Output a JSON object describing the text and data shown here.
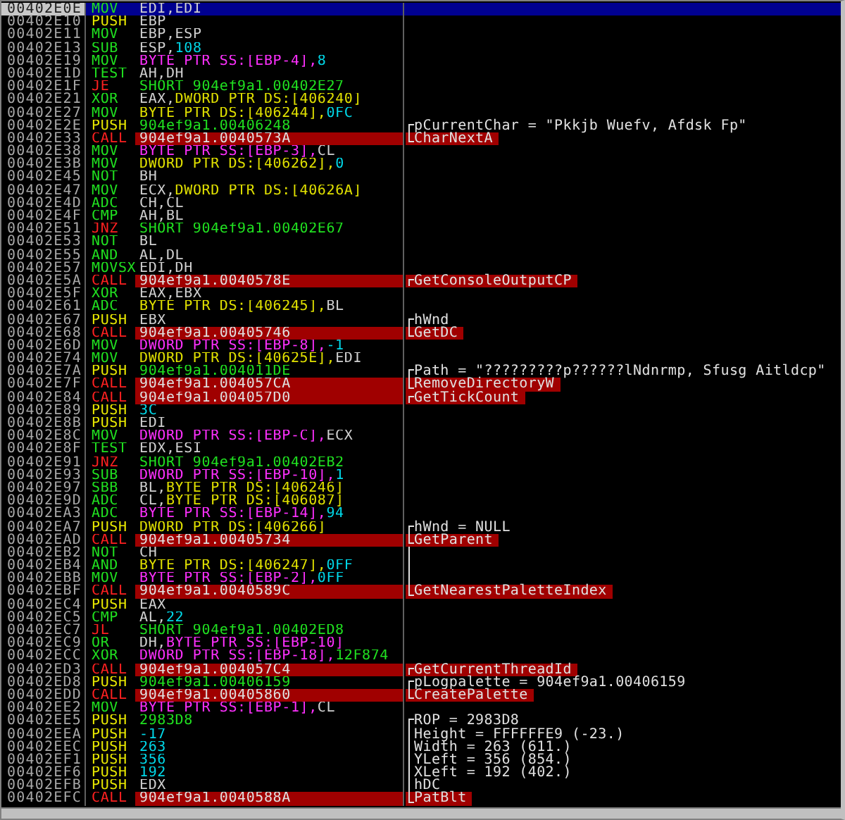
{
  "rows": [
    {
      "address": "00402E0E",
      "selected": true,
      "kind": "op",
      "mnemonic": "MOV",
      "operands": [
        {
          "text": "EDI,",
          "kind": "reg"
        },
        {
          "text": "EDI",
          "kind": "reg"
        }
      ]
    },
    {
      "address": "00402E10",
      "selected": false,
      "kind": "push",
      "mnemonic": "PUSH",
      "operands": [
        {
          "text": "EBP",
          "kind": "reg"
        }
      ]
    },
    {
      "address": "00402E11",
      "selected": false,
      "kind": "op",
      "mnemonic": "MOV",
      "operands": [
        {
          "text": "EBP,",
          "kind": "reg"
        },
        {
          "text": "ESP",
          "kind": "reg"
        }
      ]
    },
    {
      "address": "00402E13",
      "selected": false,
      "kind": "op",
      "mnemonic": "SUB",
      "operands": [
        {
          "text": "ESP,",
          "kind": "reg"
        },
        {
          "text": "108",
          "kind": "const"
        }
      ]
    },
    {
      "address": "00402E19",
      "selected": false,
      "kind": "op",
      "mnemonic": "MOV",
      "operands": [
        {
          "text": "BYTE PTR SS:[EBP-4],",
          "kind": "stack"
        },
        {
          "text": "8",
          "kind": "const"
        }
      ]
    },
    {
      "address": "00402E1D",
      "selected": false,
      "kind": "op",
      "mnemonic": "TEST",
      "operands": [
        {
          "text": "AH,",
          "kind": "reg"
        },
        {
          "text": "DH",
          "kind": "reg"
        }
      ]
    },
    {
      "address": "00402E1F",
      "selected": false,
      "kind": "jump",
      "mnemonic": "JE",
      "operands": [
        {
          "text": "SHORT 904ef9a1.00402E27",
          "kind": "addr"
        }
      ]
    },
    {
      "address": "00402E21",
      "selected": false,
      "kind": "op",
      "mnemonic": "XOR",
      "operands": [
        {
          "text": "EAX,",
          "kind": "reg"
        },
        {
          "text": "DWORD PTR DS:[406240]",
          "kind": "data"
        }
      ]
    },
    {
      "address": "00402E27",
      "selected": false,
      "kind": "op",
      "mnemonic": "MOV",
      "operands": [
        {
          "text": "BYTE PTR DS:[406244],",
          "kind": "data"
        },
        {
          "text": "0FC",
          "kind": "const"
        }
      ]
    },
    {
      "address": "00402E2E",
      "selected": false,
      "kind": "push",
      "mnemonic": "PUSH",
      "operands": [
        {
          "text": "904ef9a1.00406248",
          "kind": "addr"
        }
      ],
      "bracket": {
        "kind": "start"
      },
      "comment": {
        "text": "pCurrentChar = \"Pkkjb Wuefv, Afdsk Fp\"",
        "kind": "arg"
      }
    },
    {
      "address": "00402E33",
      "selected": false,
      "kind": "call",
      "mnemonic": "CALL",
      "operands": [
        {
          "text": "904ef9a1.0040573A",
          "kind": "addr"
        }
      ],
      "bracket": {
        "kind": "end"
      },
      "comment": {
        "text": "CharNextA",
        "kind": "api"
      }
    },
    {
      "address": "00402E38",
      "selected": false,
      "kind": "op",
      "mnemonic": "MOV",
      "operands": [
        {
          "text": "BYTE PTR SS:[EBP-3],",
          "kind": "stack"
        },
        {
          "text": "CL",
          "kind": "reg"
        }
      ]
    },
    {
      "address": "00402E3B",
      "selected": false,
      "kind": "op",
      "mnemonic": "MOV",
      "operands": [
        {
          "text": "DWORD PTR DS:[406262],",
          "kind": "data"
        },
        {
          "text": "0",
          "kind": "const"
        }
      ]
    },
    {
      "address": "00402E45",
      "selected": false,
      "kind": "op",
      "mnemonic": "NOT",
      "operands": [
        {
          "text": "BH",
          "kind": "reg"
        }
      ]
    },
    {
      "address": "00402E47",
      "selected": false,
      "kind": "op",
      "mnemonic": "MOV",
      "operands": [
        {
          "text": "ECX,",
          "kind": "reg"
        },
        {
          "text": "DWORD PTR DS:[40626A]",
          "kind": "data"
        }
      ]
    },
    {
      "address": "00402E4D",
      "selected": false,
      "kind": "op",
      "mnemonic": "ADC",
      "operands": [
        {
          "text": "CH,",
          "kind": "reg"
        },
        {
          "text": "CL",
          "kind": "reg"
        }
      ]
    },
    {
      "address": "00402E4F",
      "selected": false,
      "kind": "op",
      "mnemonic": "CMP",
      "operands": [
        {
          "text": "AH,",
          "kind": "reg"
        },
        {
          "text": "BL",
          "kind": "reg"
        }
      ]
    },
    {
      "address": "00402E51",
      "selected": false,
      "kind": "jump",
      "mnemonic": "JNZ",
      "operands": [
        {
          "text": "SHORT 904ef9a1.00402E67",
          "kind": "addr"
        }
      ]
    },
    {
      "address": "00402E53",
      "selected": false,
      "kind": "op",
      "mnemonic": "NOT",
      "operands": [
        {
          "text": "BL",
          "kind": "reg"
        }
      ]
    },
    {
      "address": "00402E55",
      "selected": false,
      "kind": "op",
      "mnemonic": "AND",
      "operands": [
        {
          "text": "AL,",
          "kind": "reg"
        },
        {
          "text": "DL",
          "kind": "reg"
        }
      ]
    },
    {
      "address": "00402E57",
      "selected": false,
      "kind": "op",
      "mnemonic": "MOVSX",
      "operands": [
        {
          "text": "EDI,",
          "kind": "reg"
        },
        {
          "text": "DH",
          "kind": "reg"
        }
      ]
    },
    {
      "address": "00402E5A",
      "selected": false,
      "kind": "call",
      "mnemonic": "CALL",
      "operands": [
        {
          "text": "904ef9a1.0040578E",
          "kind": "addr"
        }
      ],
      "bracket": {
        "kind": "single"
      },
      "comment": {
        "text": "GetConsoleOutputCP",
        "kind": "api"
      }
    },
    {
      "address": "00402E5F",
      "selected": false,
      "kind": "op",
      "mnemonic": "XOR",
      "operands": [
        {
          "text": "EAX,",
          "kind": "reg"
        },
        {
          "text": "EBX",
          "kind": "reg"
        }
      ]
    },
    {
      "address": "00402E61",
      "selected": false,
      "kind": "op",
      "mnemonic": "ADC",
      "operands": [
        {
          "text": "BYTE PTR DS:[406245],",
          "kind": "data"
        },
        {
          "text": "BL",
          "kind": "reg"
        }
      ]
    },
    {
      "address": "00402E67",
      "selected": false,
      "kind": "push",
      "mnemonic": "PUSH",
      "operands": [
        {
          "text": "EBX",
          "kind": "reg"
        }
      ],
      "bracket": {
        "kind": "start"
      },
      "comment": {
        "text": "hWnd",
        "kind": "arg"
      }
    },
    {
      "address": "00402E68",
      "selected": false,
      "kind": "call",
      "mnemonic": "CALL",
      "operands": [
        {
          "text": "904ef9a1.00405746",
          "kind": "addr"
        }
      ],
      "bracket": {
        "kind": "end"
      },
      "comment": {
        "text": "GetDC",
        "kind": "api"
      }
    },
    {
      "address": "00402E6D",
      "selected": false,
      "kind": "op",
      "mnemonic": "MOV",
      "operands": [
        {
          "text": "DWORD PTR SS:[EBP-8],",
          "kind": "stack"
        },
        {
          "text": "-1",
          "kind": "const"
        }
      ]
    },
    {
      "address": "00402E74",
      "selected": false,
      "kind": "op",
      "mnemonic": "MOV",
      "operands": [
        {
          "text": "DWORD PTR DS:[40625E],",
          "kind": "data"
        },
        {
          "text": "EDI",
          "kind": "reg"
        }
      ]
    },
    {
      "address": "00402E7A",
      "selected": false,
      "kind": "push",
      "mnemonic": "PUSH",
      "operands": [
        {
          "text": "904ef9a1.004011DE",
          "kind": "addr"
        }
      ],
      "bracket": {
        "kind": "start"
      },
      "comment": {
        "text": "Path = \"?????????p??????lNdnrmp, Sfusg Aitldcp\"",
        "kind": "arg"
      }
    },
    {
      "address": "00402E7F",
      "selected": false,
      "kind": "call",
      "mnemonic": "CALL",
      "operands": [
        {
          "text": "904ef9a1.004057CA",
          "kind": "addr"
        }
      ],
      "bracket": {
        "kind": "end"
      },
      "comment": {
        "text": "RemoveDirectoryW",
        "kind": "api"
      }
    },
    {
      "address": "00402E84",
      "selected": false,
      "kind": "call",
      "mnemonic": "CALL",
      "operands": [
        {
          "text": "904ef9a1.004057D0",
          "kind": "addr"
        }
      ],
      "bracket": {
        "kind": "single"
      },
      "comment": {
        "text": "GetTickCount",
        "kind": "api"
      }
    },
    {
      "address": "00402E89",
      "selected": false,
      "kind": "push",
      "mnemonic": "PUSH",
      "operands": [
        {
          "text": "3C",
          "kind": "const"
        }
      ]
    },
    {
      "address": "00402E8B",
      "selected": false,
      "kind": "push",
      "mnemonic": "PUSH",
      "operands": [
        {
          "text": "EDI",
          "kind": "reg"
        }
      ]
    },
    {
      "address": "00402E8C",
      "selected": false,
      "kind": "op",
      "mnemonic": "MOV",
      "operands": [
        {
          "text": "DWORD PTR SS:[EBP-C],",
          "kind": "stack"
        },
        {
          "text": "ECX",
          "kind": "reg"
        }
      ]
    },
    {
      "address": "00402E8F",
      "selected": false,
      "kind": "op",
      "mnemonic": "TEST",
      "operands": [
        {
          "text": "EDX,",
          "kind": "reg"
        },
        {
          "text": "ESI",
          "kind": "reg"
        }
      ]
    },
    {
      "address": "00402E91",
      "selected": false,
      "kind": "jump",
      "mnemonic": "JNZ",
      "operands": [
        {
          "text": "SHORT 904ef9a1.00402EB2",
          "kind": "addr"
        }
      ]
    },
    {
      "address": "00402E93",
      "selected": false,
      "kind": "op",
      "mnemonic": "SUB",
      "operands": [
        {
          "text": "DWORD PTR SS:[EBP-10],",
          "kind": "stack"
        },
        {
          "text": "1",
          "kind": "const"
        }
      ]
    },
    {
      "address": "00402E97",
      "selected": false,
      "kind": "op",
      "mnemonic": "SBB",
      "operands": [
        {
          "text": "BL,",
          "kind": "reg"
        },
        {
          "text": "BYTE PTR DS:[406246]",
          "kind": "data"
        }
      ]
    },
    {
      "address": "00402E9D",
      "selected": false,
      "kind": "op",
      "mnemonic": "ADC",
      "operands": [
        {
          "text": "CL,",
          "kind": "reg"
        },
        {
          "text": "BYTE PTR DS:[406087]",
          "kind": "data"
        }
      ]
    },
    {
      "address": "00402EA3",
      "selected": false,
      "kind": "op",
      "mnemonic": "ADC",
      "operands": [
        {
          "text": "BYTE PTR SS:[EBP-14],",
          "kind": "stack"
        },
        {
          "text": "94",
          "kind": "const"
        }
      ]
    },
    {
      "address": "00402EA7",
      "selected": false,
      "kind": "push",
      "mnemonic": "PUSH",
      "operands": [
        {
          "text": "DWORD PTR DS:[406266]",
          "kind": "data"
        }
      ],
      "bracket": {
        "kind": "start"
      },
      "comment": {
        "text": "hWnd = NULL",
        "kind": "arg"
      }
    },
    {
      "address": "00402EAD",
      "selected": false,
      "kind": "call",
      "mnemonic": "CALL",
      "operands": [
        {
          "text": "904ef9a1.00405734",
          "kind": "addr"
        }
      ],
      "bracket": {
        "kind": "end"
      },
      "comment": {
        "text": "GetParent",
        "kind": "api"
      }
    },
    {
      "address": "00402EB2",
      "selected": false,
      "kind": "op",
      "mnemonic": "NOT",
      "operands": [
        {
          "text": "CH",
          "kind": "reg"
        }
      ],
      "bracket": {
        "kind": "middle"
      }
    },
    {
      "address": "00402EB4",
      "selected": false,
      "kind": "op",
      "mnemonic": "AND",
      "operands": [
        {
          "text": "BYTE PTR DS:[406247],",
          "kind": "data"
        },
        {
          "text": "0FF",
          "kind": "const"
        }
      ],
      "bracket": {
        "kind": "middle"
      }
    },
    {
      "address": "00402EBB",
      "selected": false,
      "kind": "op",
      "mnemonic": "MOV",
      "operands": [
        {
          "text": "BYTE PTR SS:[EBP-2],",
          "kind": "stack"
        },
        {
          "text": "0FF",
          "kind": "const"
        }
      ],
      "bracket": {
        "kind": "middle"
      }
    },
    {
      "address": "00402EBF",
      "selected": false,
      "kind": "call",
      "mnemonic": "CALL",
      "operands": [
        {
          "text": "904ef9a1.0040589C",
          "kind": "addr"
        }
      ],
      "bracket": {
        "kind": "end"
      },
      "comment": {
        "text": "GetNearestPaletteIndex",
        "kind": "api"
      }
    },
    {
      "address": "00402EC4",
      "selected": false,
      "kind": "push",
      "mnemonic": "PUSH",
      "operands": [
        {
          "text": "EAX",
          "kind": "reg"
        }
      ]
    },
    {
      "address": "00402EC5",
      "selected": false,
      "kind": "op",
      "mnemonic": "CMP",
      "operands": [
        {
          "text": "AL,",
          "kind": "reg"
        },
        {
          "text": "22",
          "kind": "const"
        }
      ]
    },
    {
      "address": "00402EC7",
      "selected": false,
      "kind": "jump",
      "mnemonic": "JL",
      "operands": [
        {
          "text": "SHORT 904ef9a1.00402ED8",
          "kind": "addr"
        }
      ]
    },
    {
      "address": "00402EC9",
      "selected": false,
      "kind": "op",
      "mnemonic": "OR",
      "operands": [
        {
          "text": "DH,",
          "kind": "reg"
        },
        {
          "text": "BYTE PTR SS:[EBP-10]",
          "kind": "stack"
        }
      ]
    },
    {
      "address": "00402ECC",
      "selected": false,
      "kind": "op",
      "mnemonic": "XOR",
      "operands": [
        {
          "text": "DWORD PTR SS:[EBP-18],",
          "kind": "stack"
        },
        {
          "text": "12F874",
          "kind": "addr"
        }
      ]
    },
    {
      "address": "00402ED3",
      "selected": false,
      "kind": "call",
      "mnemonic": "CALL",
      "operands": [
        {
          "text": "904ef9a1.004057C4",
          "kind": "addr"
        }
      ],
      "bracket": {
        "kind": "single"
      },
      "comment": {
        "text": "GetCurrentThreadId",
        "kind": "api"
      }
    },
    {
      "address": "00402ED8",
      "selected": false,
      "kind": "push",
      "mnemonic": "PUSH",
      "operands": [
        {
          "text": "904ef9a1.00406159",
          "kind": "addr"
        }
      ],
      "bracket": {
        "kind": "start"
      },
      "comment": {
        "text": "pLogpalette = 904ef9a1.00406159",
        "kind": "arg"
      }
    },
    {
      "address": "00402EDD",
      "selected": false,
      "kind": "call",
      "mnemonic": "CALL",
      "operands": [
        {
          "text": "904ef9a1.00405860",
          "kind": "addr"
        }
      ],
      "bracket": {
        "kind": "end"
      },
      "comment": {
        "text": "CreatePalette",
        "kind": "api"
      }
    },
    {
      "address": "00402EE2",
      "selected": false,
      "kind": "op",
      "mnemonic": "MOV",
      "operands": [
        {
          "text": "BYTE PTR SS:[EBP-1],",
          "kind": "stack"
        },
        {
          "text": "CL",
          "kind": "reg"
        }
      ]
    },
    {
      "address": "00402EE5",
      "selected": false,
      "kind": "push",
      "mnemonic": "PUSH",
      "operands": [
        {
          "text": "2983D8",
          "kind": "addr"
        }
      ],
      "bracket": {
        "kind": "start"
      },
      "comment": {
        "text": "ROP = 2983D8",
        "kind": "arg"
      }
    },
    {
      "address": "00402EEA",
      "selected": false,
      "kind": "push",
      "mnemonic": "PUSH",
      "operands": [
        {
          "text": "-17",
          "kind": "const"
        }
      ],
      "bracket": {
        "kind": "middle"
      },
      "comment": {
        "text": "Height = FFFFFFE9 (-23.)",
        "kind": "arg"
      }
    },
    {
      "address": "00402EEC",
      "selected": false,
      "kind": "push",
      "mnemonic": "PUSH",
      "operands": [
        {
          "text": "263",
          "kind": "const"
        }
      ],
      "bracket": {
        "kind": "middle"
      },
      "comment": {
        "text": "Width = 263 (611.)",
        "kind": "arg"
      }
    },
    {
      "address": "00402EF1",
      "selected": false,
      "kind": "push",
      "mnemonic": "PUSH",
      "operands": [
        {
          "text": "356",
          "kind": "const"
        }
      ],
      "bracket": {
        "kind": "middle"
      },
      "comment": {
        "text": "YLeft = 356 (854.)",
        "kind": "arg"
      }
    },
    {
      "address": "00402EF6",
      "selected": false,
      "kind": "push",
      "mnemonic": "PUSH",
      "operands": [
        {
          "text": "192",
          "kind": "const"
        }
      ],
      "bracket": {
        "kind": "middle"
      },
      "comment": {
        "text": "XLeft = 192 (402.)",
        "kind": "arg"
      }
    },
    {
      "address": "00402EFB",
      "selected": false,
      "kind": "push",
      "mnemonic": "PUSH",
      "operands": [
        {
          "text": "EDX",
          "kind": "reg"
        }
      ],
      "bracket": {
        "kind": "middle"
      },
      "comment": {
        "text": "hDC",
        "kind": "arg"
      }
    },
    {
      "address": "00402EFC",
      "selected": false,
      "kind": "call",
      "mnemonic": "CALL",
      "operands": [
        {
          "text": "904ef9a1.0040588A",
          "kind": "addr"
        }
      ],
      "bracket": {
        "kind": "end"
      },
      "comment": {
        "text": "PatBlt",
        "kind": "api"
      }
    }
  ]
}
